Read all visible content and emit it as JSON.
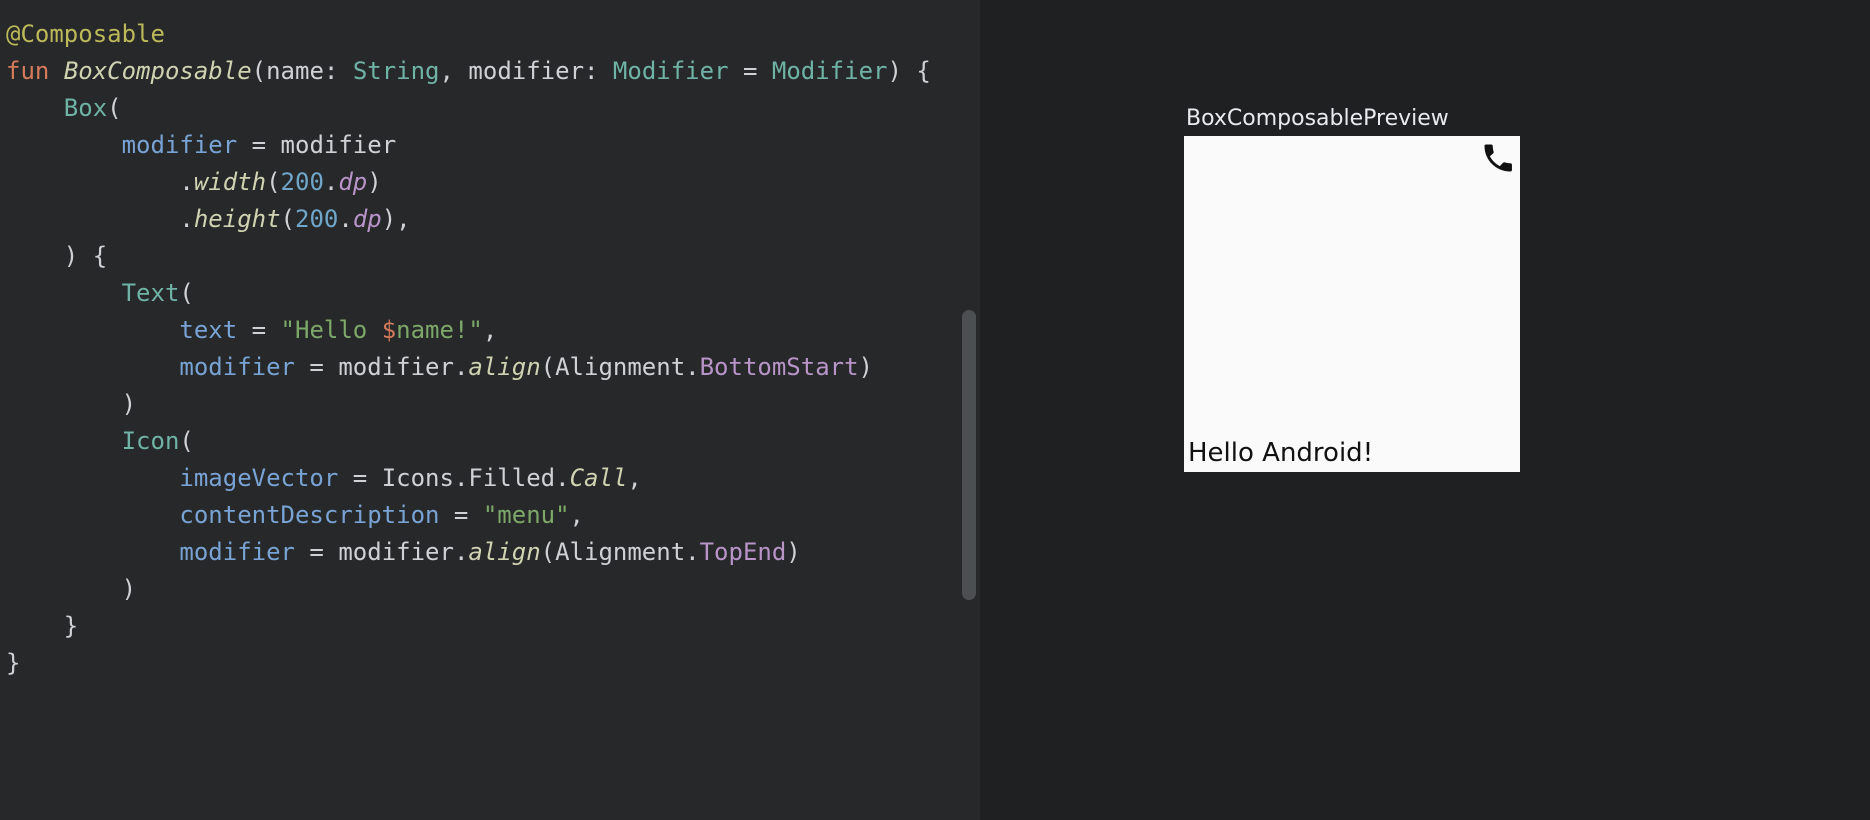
{
  "code": {
    "annotation": "@Composable",
    "kw_fun": "fun",
    "fn_name": "BoxComposable",
    "param_name1": "name",
    "type_string": "String",
    "param_name2": "modifier",
    "type_modifier": "Modifier",
    "default_modifier": "Modifier",
    "call_box": "Box",
    "arg_modifier": "modifier",
    "val_modifier": "modifier",
    "ext_width": "width",
    "num_200a": "200",
    "dp_a": "dp",
    "ext_height": "height",
    "num_200b": "200",
    "dp_b": "dp",
    "call_text": "Text",
    "arg_text": "text",
    "str_open": "\"Hello ",
    "str_dollar": "$",
    "str_var": "name",
    "str_close": "!\"",
    "ext_align1": "align",
    "const_alignment1": "Alignment",
    "field_bottomstart": "BottomStart",
    "call_icon": "Icon",
    "arg_imagevector": "imageVector",
    "const_icons": "Icons",
    "field_filled": "Filled",
    "field_call": "Call",
    "arg_contentdesc": "contentDescription",
    "str_menu": "\"menu\"",
    "ext_align2": "align",
    "const_alignment2": "Alignment",
    "field_topend": "TopEnd"
  },
  "preview": {
    "title": "BoxComposablePreview",
    "text": "Hello Android!",
    "icon_name": "call-icon"
  }
}
